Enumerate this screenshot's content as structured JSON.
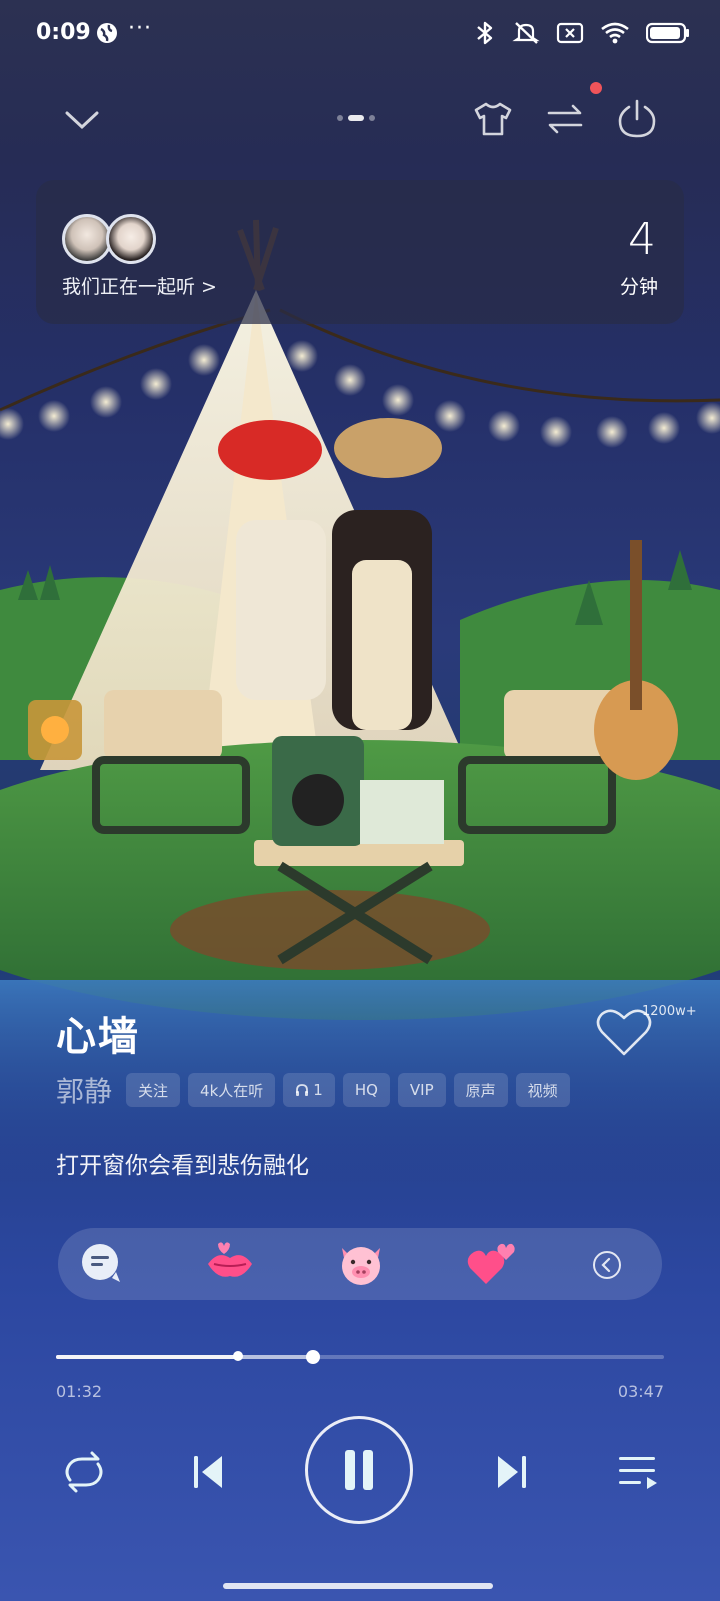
{
  "status_bar": {
    "time": "0:09",
    "more": "···"
  },
  "icons": {
    "collapse": "chevron-down-icon",
    "outfit": "tshirt-icon",
    "switch": "swap-arrows-icon",
    "power": "power-icon"
  },
  "listen_together": {
    "label": "我们正在一起听 >",
    "minutes": "4",
    "unit": "分钟"
  },
  "song": {
    "title": "心墙",
    "artist": "郭静",
    "like_count": "1200w+",
    "tags": [
      "关注",
      "4k人在听",
      "1",
      "HQ",
      "VIP",
      "原声",
      "视频"
    ],
    "lyric": "打开窗你会看到悲伤融化"
  },
  "reactions": [
    "chat-bubble-icon",
    "lips-icon",
    "pig-face-icon",
    "hearts-icon",
    "collapse-left-icon"
  ],
  "player": {
    "elapsed": "01:32",
    "total": "03:47",
    "progress": 0.299,
    "buffered": 0.422
  },
  "colors": {
    "accent": "#f4f4f8",
    "badge_red": "#f0545a"
  }
}
